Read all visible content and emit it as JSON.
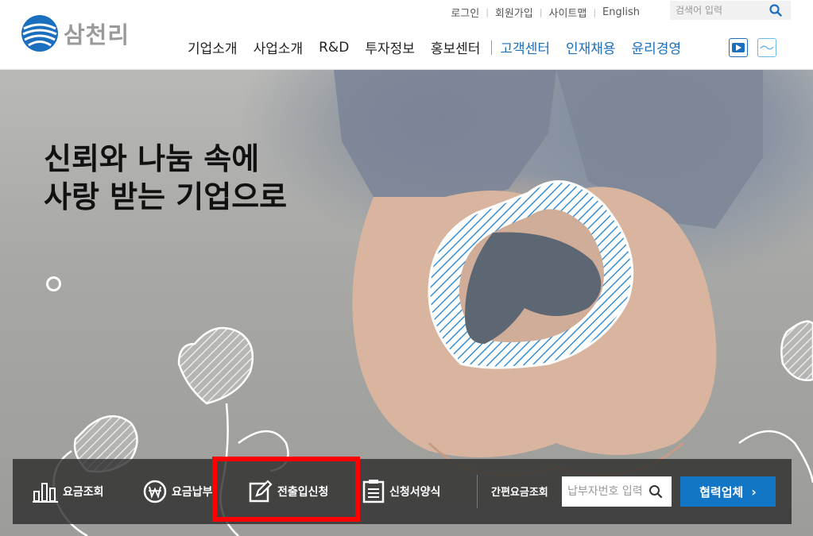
{
  "brand": {
    "logo_text": "삼천리",
    "brand_color": "#1a6fbf"
  },
  "util_nav": {
    "items": [
      "로그인",
      "회원가입",
      "사이트맵",
      "English"
    ]
  },
  "search": {
    "placeholder": "검색어 입력",
    "icon": "search-icon"
  },
  "gnb": {
    "main_items": [
      "기업소개",
      "사업소개",
      "R&D",
      "투자정보",
      "홍보센터"
    ],
    "blue_items": [
      "고객센터",
      "인재채용",
      "윤리경영"
    ],
    "sns_icons": [
      "youtube-icon",
      "social-icon"
    ]
  },
  "hero": {
    "title_line1": "신뢰와 나눔 속에",
    "title_line2": "사랑 받는 기업으로"
  },
  "quick_menu": {
    "items": [
      {
        "label": "요금조회",
        "icon": "bar-chart-icon"
      },
      {
        "label": "요금납부",
        "icon": "won-icon"
      },
      {
        "label": "전출입신청",
        "icon": "edit-icon"
      },
      {
        "label": "신청서양식",
        "icon": "document-icon"
      }
    ],
    "quick_fee_label": "간편요금조회",
    "payer_input_placeholder": "납부자번호 입력",
    "partner_button": "협력업체",
    "partner_chevron": "›"
  },
  "colors": {
    "accent": "#1275c6",
    "highlight": "#ff0000",
    "bar_bg": "#333333"
  }
}
